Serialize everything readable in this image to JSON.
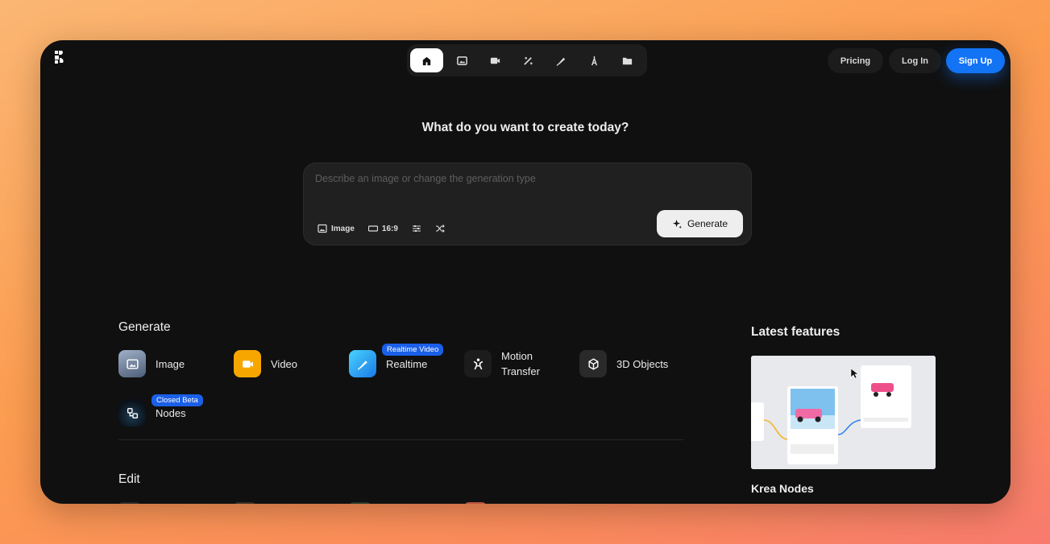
{
  "nav": {
    "items": [
      {
        "name": "home",
        "active": true
      },
      {
        "name": "image"
      },
      {
        "name": "video"
      },
      {
        "name": "enhance"
      },
      {
        "name": "realtime"
      },
      {
        "name": "train"
      },
      {
        "name": "assets"
      }
    ]
  },
  "header": {
    "pricing": "Pricing",
    "login": "Log In",
    "signup": "Sign Up"
  },
  "hero": {
    "headline": "What do you want to create today?"
  },
  "prompt": {
    "placeholder": "Describe an image or change the generation type",
    "type_label": "Image",
    "aspect_label": "16:9",
    "generate_label": "Generate"
  },
  "generate": {
    "title": "Generate",
    "tools": [
      {
        "label": "Image",
        "icon": "image-icon"
      },
      {
        "label": "Video",
        "icon": "video-icon"
      },
      {
        "label": "Realtime",
        "icon": "realtime-icon",
        "badge": "Realtime Video"
      },
      {
        "label": "Motion Transfer",
        "icon": "motion-transfer-icon"
      },
      {
        "label": "3D Objects",
        "icon": "cube-icon"
      },
      {
        "label": "Nodes",
        "icon": "nodes-icon",
        "badge": "Closed Beta"
      }
    ]
  },
  "edit": {
    "title": "Edit"
  },
  "latest": {
    "title": "Latest features",
    "feature_name": "Krea Nodes"
  },
  "colors": {
    "accent": "#1373f5",
    "badge": "#1a5fe8",
    "video": "#f7a600",
    "realtime": "#1fa7f2"
  }
}
